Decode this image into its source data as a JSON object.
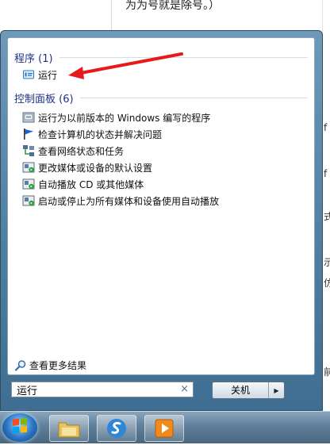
{
  "background": {
    "top_text": "为为号就是除号。）",
    "edge_chars": [
      "f",
      "f",
      "式",
      "示",
      "仿",
      "前"
    ]
  },
  "start_menu": {
    "programs": {
      "header": "程序 (1)",
      "items": [
        {
          "label": "运行",
          "icon": "run-icon"
        }
      ]
    },
    "control_panel": {
      "header": "控制面板 (6)",
      "items": [
        {
          "label": "运行为以前版本的 Windows 编写的程序",
          "icon": "compat-icon"
        },
        {
          "label": "检查计算机的状态并解决问题",
          "icon": "flag-icon"
        },
        {
          "label": "查看网络状态和任务",
          "icon": "network-icon"
        },
        {
          "label": "更改媒体或设备的默认设置",
          "icon": "autoplay-icon"
        },
        {
          "label": "自动播放 CD 或其他媒体",
          "icon": "autoplay-icon"
        },
        {
          "label": "启动或停止为所有媒体和设备使用自动播放",
          "icon": "autoplay-icon"
        }
      ]
    },
    "see_more": "查看更多结果",
    "search": {
      "value": "运行",
      "clear": "×"
    },
    "shutdown": {
      "label": "关机",
      "arrow": "▶"
    }
  },
  "annotation": {
    "color": "#e8191c"
  },
  "taskbar": {
    "items": [
      "start-orb",
      "file-explorer",
      "sogou-app",
      "media-player"
    ]
  }
}
